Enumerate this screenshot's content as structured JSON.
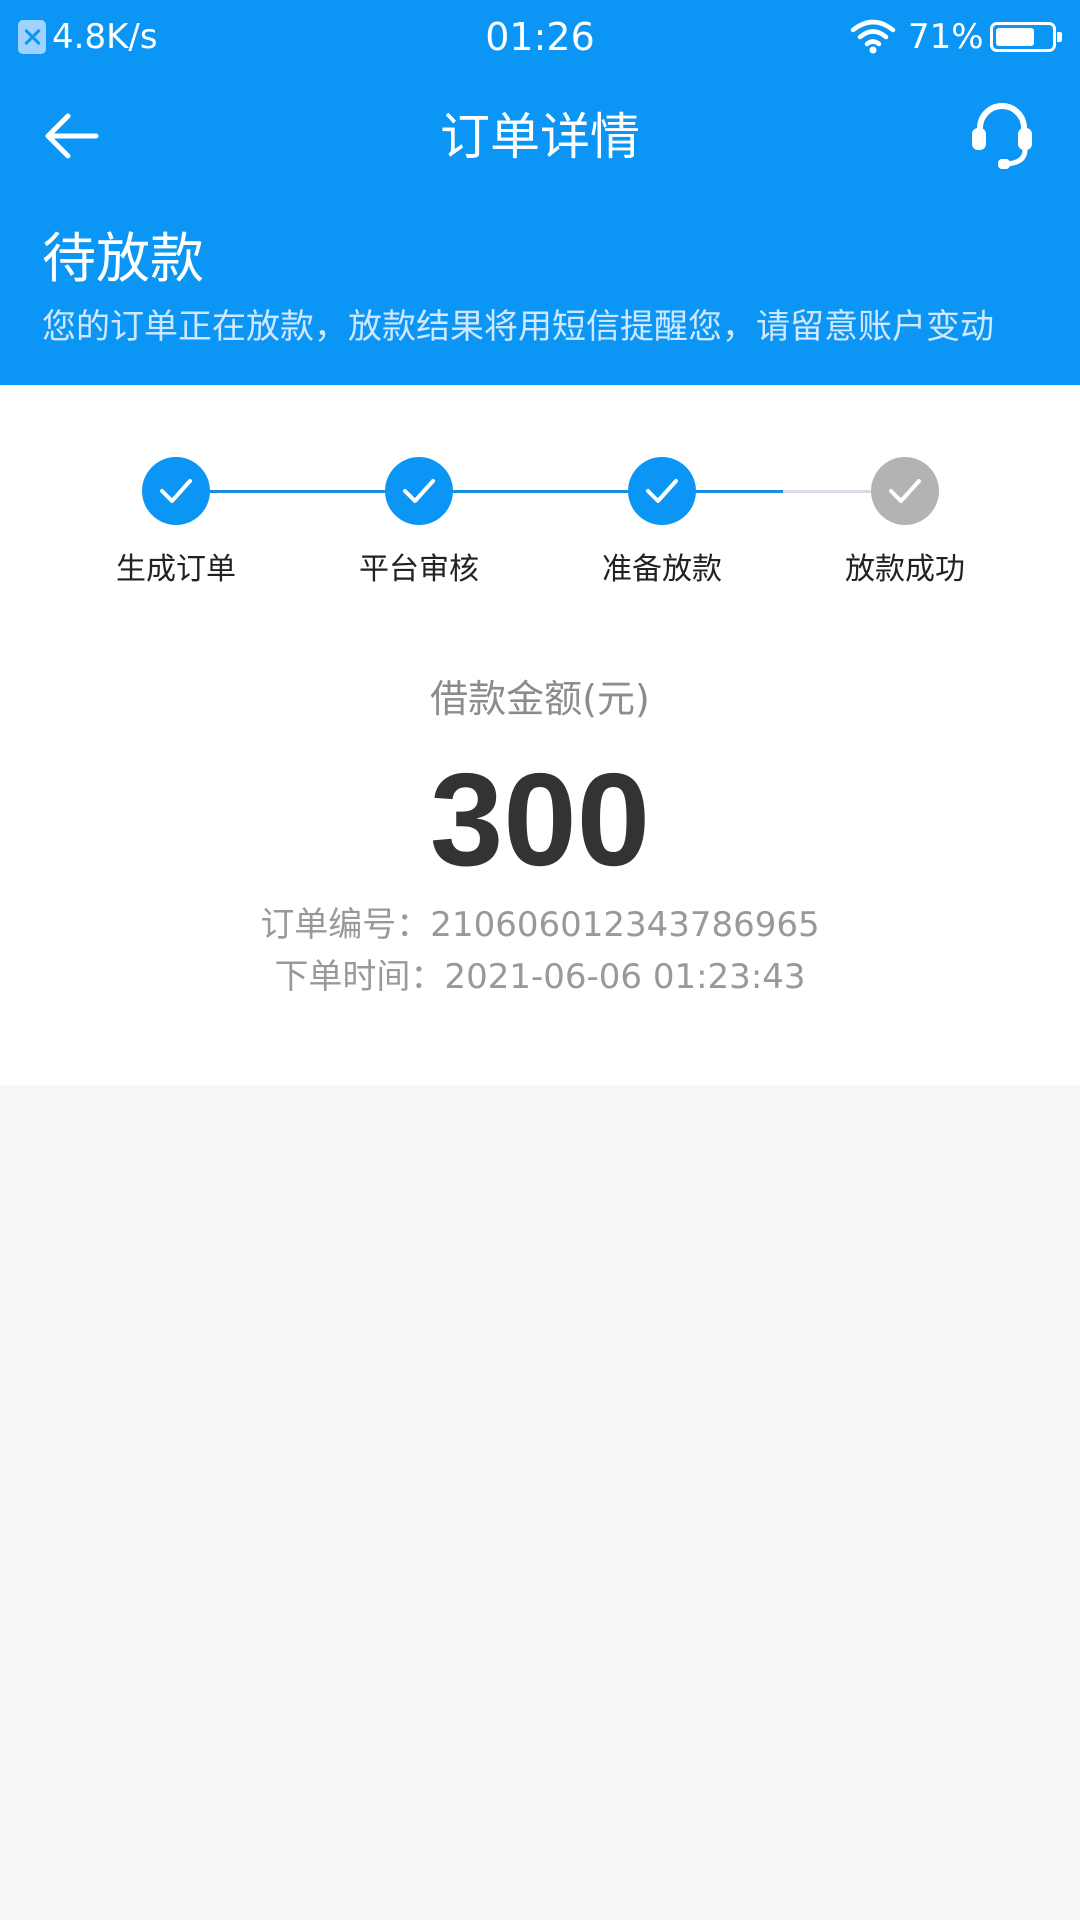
{
  "status_bar": {
    "net_speed": "4.8K/s",
    "time": "01:26",
    "battery_percent": "71%",
    "battery_level": 0.71,
    "icons": [
      "network-blocked-icon",
      "wifi-icon",
      "battery-icon"
    ]
  },
  "nav": {
    "title": "订单详情",
    "back_icon": "back-arrow-icon",
    "service_icon": "headset-icon"
  },
  "order_status": {
    "title": "待放款",
    "description": "您的订单正在放款，放款结果将用短信提醒您，请留意账户变动"
  },
  "steps": [
    {
      "label": "生成订单",
      "done": true
    },
    {
      "label": "平台审核",
      "done": true
    },
    {
      "label": "准备放款",
      "done": true
    },
    {
      "label": "放款成功",
      "done": false
    }
  ],
  "amount": {
    "label": "借款金额(元)",
    "value": "300"
  },
  "order_info": {
    "order_no": "订单编号：210606012343786965",
    "order_time": "下单时间：2021-06-06 01:23:43"
  },
  "colors": {
    "primary": "#0b96f5",
    "step_done": "#0b96f5",
    "step_todo": "#b3b3b3",
    "text_dark": "#333333",
    "text_muted": "#999999",
    "page_bg": "#f7f7f7"
  }
}
